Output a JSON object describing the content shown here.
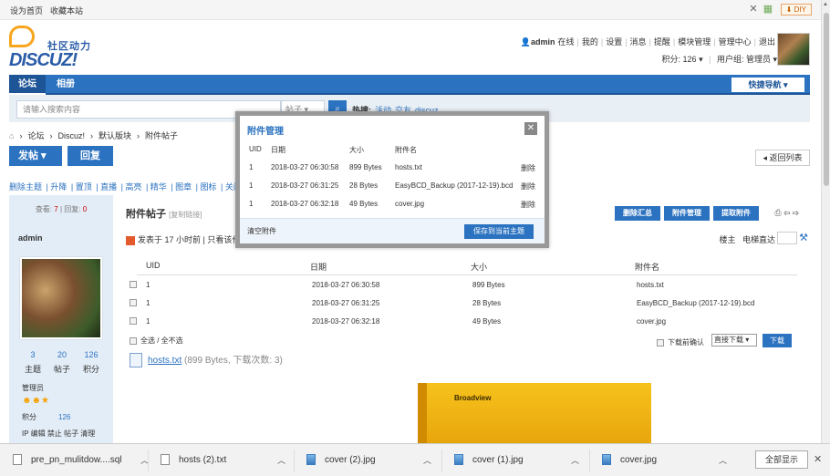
{
  "topbar": {
    "set_home": "设为首页",
    "bookmark": "收藏本站",
    "diy": "DIY"
  },
  "logo": {
    "cn": "社区动力",
    "en": "DISCUZ!"
  },
  "user_menu": {
    "username": "admin",
    "status": "在线",
    "items": [
      "我的",
      "设置",
      "消息",
      "提醒",
      "模块管理",
      "管理中心",
      "退出"
    ],
    "points_label": "积分: 126",
    "group_label": "用户组: 管理员"
  },
  "nav": {
    "tabs": [
      "论坛",
      "相册"
    ],
    "quick_nav": "快捷导航"
  },
  "search": {
    "placeholder": "请输入搜索内容",
    "type": "帖子",
    "hot_label": "热搜:",
    "hot_terms": [
      "活动",
      "交友",
      "discuz"
    ]
  },
  "breadcrumb": [
    "论坛",
    "Discuz!",
    "默认版块",
    "附件帖子"
  ],
  "actions": {
    "post": "发帖",
    "reply": "回复",
    "back_list": "返回列表"
  },
  "mod_bar": [
    "删除主题",
    "升降",
    "置顶",
    "直播",
    "高亮",
    "精华",
    "图章",
    "图标",
    "关闭"
  ],
  "sidebar": {
    "stats_prefix": "查看:",
    "views": "7",
    "replies_prefix": "回复:",
    "replies": "0",
    "username": "admin",
    "counts": [
      {
        "value": "3",
        "label": "主题"
      },
      {
        "value": "20",
        "label": "帖子"
      },
      {
        "value": "126",
        "label": "积分"
      }
    ],
    "role": "管理员",
    "points_label": "积分",
    "points_value": "126",
    "ip_tools": "IP 编辑 禁止 帖子 清理"
  },
  "post": {
    "title": "附件帖子",
    "copy_link": "[复制链接]",
    "buttons": [
      "删除汇总",
      "附件管理",
      "提取附件"
    ],
    "meta": "发表于 17 小时前",
    "only_author": "只看该作者",
    "floor": "楼主",
    "jump": "电梯直达"
  },
  "table": {
    "headers": [
      "UID",
      "日期",
      "大小",
      "附件名"
    ],
    "rows": [
      [
        "1",
        "2018-03-27 06:30:58",
        "899 Bytes",
        "hosts.txt"
      ],
      [
        "1",
        "2018-03-27 06:31:25",
        "28 Bytes",
        "EasyBCD_Backup (2017-12-19).bcd"
      ],
      [
        "1",
        "2018-03-27 06:32:18",
        "49 Bytes",
        "cover.jpg"
      ]
    ],
    "select_all": "全选 / 全不选",
    "download_confirm": "下载前确认",
    "download_mode": "直接下载",
    "download_btn": "下载"
  },
  "attachment": {
    "name": "hosts.txt",
    "desc": "(899 Bytes, 下载次数: 3)"
  },
  "product_label": "Broadview",
  "dialog": {
    "title": "附件管理",
    "headers": [
      "UID",
      "日期",
      "大小",
      "附件名"
    ],
    "rows": [
      [
        "1",
        "2018-03-27 06:30:58",
        "899 Bytes",
        "hosts.txt",
        "删除"
      ],
      [
        "1",
        "2018-03-27 06:31:25",
        "28 Bytes",
        "EasyBCD_Backup (2017-12-19).bcd",
        "删除"
      ],
      [
        "1",
        "2018-03-27 06:32:18",
        "49 Bytes",
        "cover.jpg",
        "删除"
      ]
    ],
    "clear": "清空附件",
    "save": "保存到当前主题"
  },
  "downloads": {
    "items": [
      "pre_pn_mulitdow....sql",
      "hosts (2).txt",
      "cover (2).jpg",
      "cover (1).jpg",
      "cover.jpg"
    ],
    "show_all": "全部显示"
  },
  "colors": {
    "brand": "#2b72c0",
    "accent": "#f7a51d",
    "sidebar_bg": "#e3edf7"
  }
}
